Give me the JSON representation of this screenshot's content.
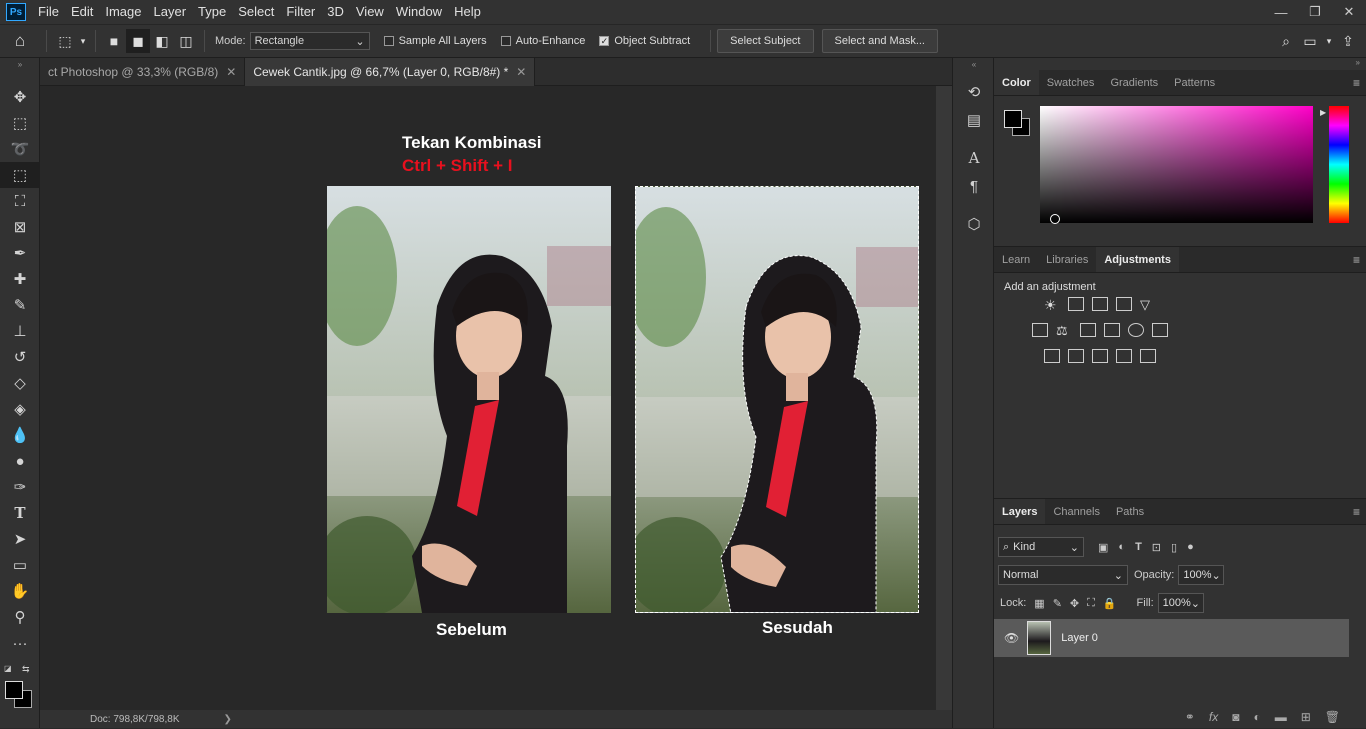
{
  "menubar": {
    "logo": "Ps",
    "items": [
      "File",
      "Edit",
      "Image",
      "Layer",
      "Type",
      "Select",
      "Filter",
      "3D",
      "View",
      "Window",
      "Help"
    ],
    "controls": {
      "minimize": "—",
      "restore": "❐",
      "close": "✕"
    }
  },
  "options": {
    "mode_label": "Mode:",
    "mode_value": "Rectangle",
    "sample_all_layers": "Sample All Layers",
    "auto_enhance": "Auto-Enhance",
    "object_subtract": "Object Subtract",
    "select_subject": "Select Subject",
    "select_and_mask": "Select and Mask..."
  },
  "tabs": [
    {
      "label": "ct Photoshop @ 33,3% (RGB/8)",
      "close": "✕"
    },
    {
      "label": "Cewek Cantik.jpg @ 66,7% (Layer 0, RGB/8#) *",
      "close": "✕"
    }
  ],
  "canvas": {
    "instruction_title": "Tekan Kombinasi",
    "instruction_keys": "Ctrl + Shift + I",
    "before_label": "Sebelum",
    "after_label": "Sesudah"
  },
  "status": {
    "doc": "Doc: 798,8K/798,8K",
    "arrow": "❯"
  },
  "color_panel": {
    "tabs": [
      "Color",
      "Swatches",
      "Gradients",
      "Patterns"
    ],
    "colors": {
      "foreground": "#000000",
      "background": "#000000",
      "hue": "#ff00c8"
    }
  },
  "adjust_panel": {
    "tabs": [
      "Learn",
      "Libraries",
      "Adjustments"
    ],
    "heading": "Add an adjustment"
  },
  "layers_panel": {
    "tabs": [
      "Layers",
      "Channels",
      "Paths"
    ],
    "filter_kind": "Kind",
    "blend_mode": "Normal",
    "opacity_label": "Opacity:",
    "opacity_value": "100%",
    "lock_label": "Lock:",
    "fill_label": "Fill:",
    "fill_value": "100%",
    "layer_name": "Layer 0"
  },
  "colors": {
    "accent_red": "#e8101e"
  }
}
